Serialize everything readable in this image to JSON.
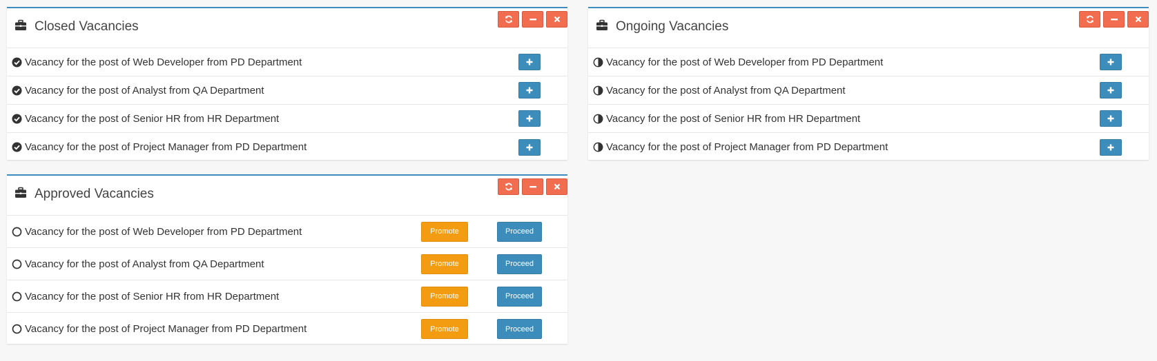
{
  "colors": {
    "panel_border": "#3c8dbc",
    "tool_button": "#f26c4f",
    "add_button": "#3c8dbc",
    "promote_button": "#f39c12",
    "proceed_button": "#3c8dbc"
  },
  "closed": {
    "title": "Closed Vacancies",
    "icon": "briefcase-icon",
    "status_icon": "check-circle-icon",
    "items": [
      "Vacancy for the post of Web Developer from PD Department",
      "Vacancy for the post of Analyst from QA Department",
      "Vacancy for the post of Senior HR from HR Department",
      "Vacancy for the post of Project Manager from PD Department"
    ]
  },
  "ongoing": {
    "title": "Ongoing Vacancies",
    "icon": "briefcase-icon",
    "status_icon": "half-circle-icon",
    "items": [
      "Vacancy for the post of Web Developer from PD Department",
      "Vacancy for the post of Analyst from QA Department",
      "Vacancy for the post of Senior HR from HR Department",
      "Vacancy for the post of Project Manager from PD Department"
    ]
  },
  "approved": {
    "title": "Approved Vacancies",
    "icon": "briefcase-icon",
    "status_icon": "empty-circle-icon",
    "promote_label": "Promote",
    "proceed_label": "Proceed",
    "items": [
      "Vacancy for the post of Web Developer from PD Department",
      "Vacancy for the post of Analyst from QA Department",
      "Vacancy for the post of Senior HR from HR Department",
      "Vacancy for the post of Project Manager from PD Department"
    ]
  },
  "tools": {
    "refresh_icon": "refresh-icon",
    "minimize_icon": "minus-icon",
    "close_icon": "close-icon"
  }
}
